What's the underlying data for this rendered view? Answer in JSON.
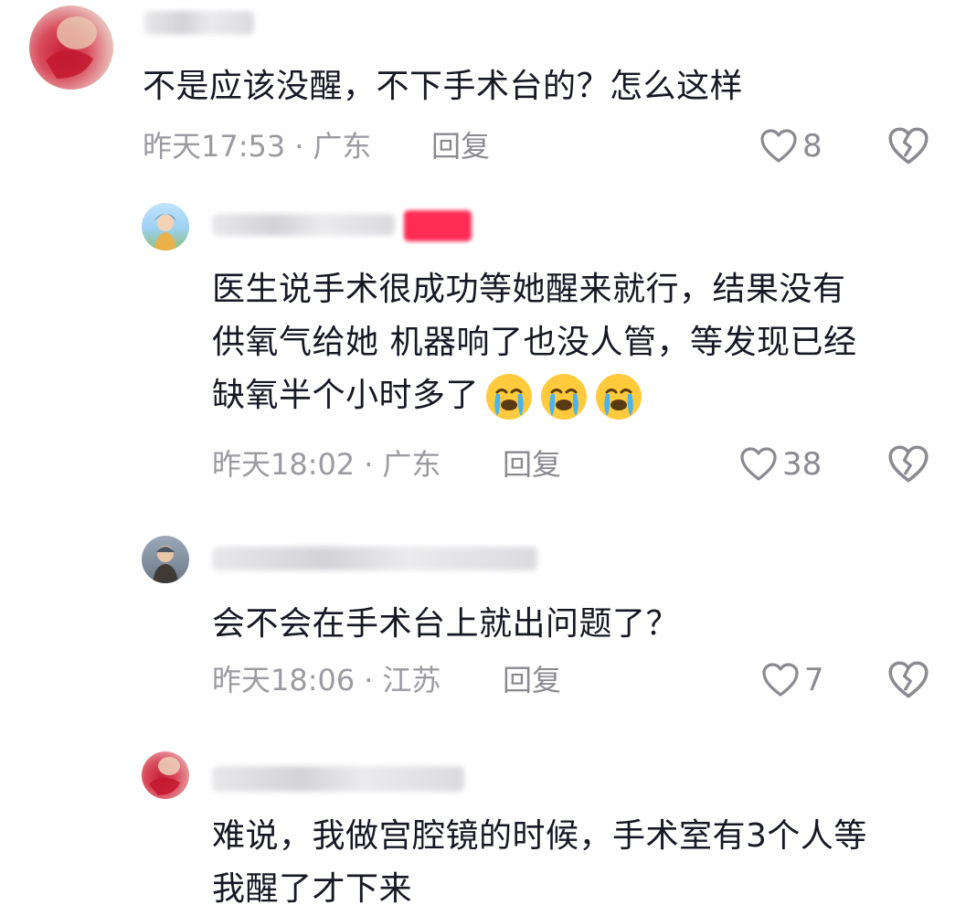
{
  "comments": [
    {
      "text_lines": [
        "不是应该没醒，不下手术台的？怎么这样"
      ],
      "time": "昨天17:53",
      "separator": "·",
      "location": "广东",
      "reply_label": "回复",
      "likes": "8"
    },
    {
      "text_lines": [
        "医生说手术很成功等她醒来就行，结果没有",
        "供氧气给她 机器响了也没人管，等发现已经",
        "缺氧半个小时多了"
      ],
      "emojis": [
        "crying-face",
        "crying-face",
        "crying-face"
      ],
      "time": "昨天18:02",
      "separator": "·",
      "location": "广东",
      "reply_label": "回复",
      "likes": "38"
    },
    {
      "text_lines": [
        "会不会在手术台上就出问题了？"
      ],
      "time": "昨天18:06",
      "separator": "·",
      "location": "江苏",
      "reply_label": "回复",
      "likes": "7"
    },
    {
      "text_lines": [
        "难说，我做宫腔镜的时候，手术室有3个人等",
        "我醒了才下来"
      ]
    }
  ],
  "colors": {
    "author_badge": "#fe2c55",
    "text": "#161823",
    "meta": "#9a9aa1"
  }
}
